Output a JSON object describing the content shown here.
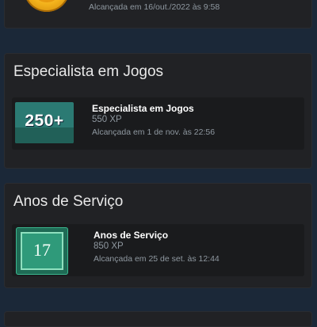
{
  "top_card": {
    "date": "Alcançada em 16/out./2022 às 9:58"
  },
  "sections": [
    {
      "title": "Especialista em Jogos",
      "badge": {
        "icon": "250-plus-badge-icon",
        "icon_text": "250+",
        "name": "Especialista em Jogos",
        "xp": "550 XP",
        "date": "Alcançada em 1 de nov. às 22:56"
      }
    },
    {
      "title": "Anos de Serviço",
      "badge": {
        "icon": "years-of-service-badge-icon",
        "icon_text": "17",
        "name": "Anos de Serviço",
        "xp": "850 XP",
        "date": "Alcançada em 25 de set. às 12:44"
      }
    }
  ],
  "colors": {
    "background": "#1b2838",
    "card": "#212225",
    "teal_badge": "#2b7a73",
    "green_badge": "#2f9a7a"
  }
}
